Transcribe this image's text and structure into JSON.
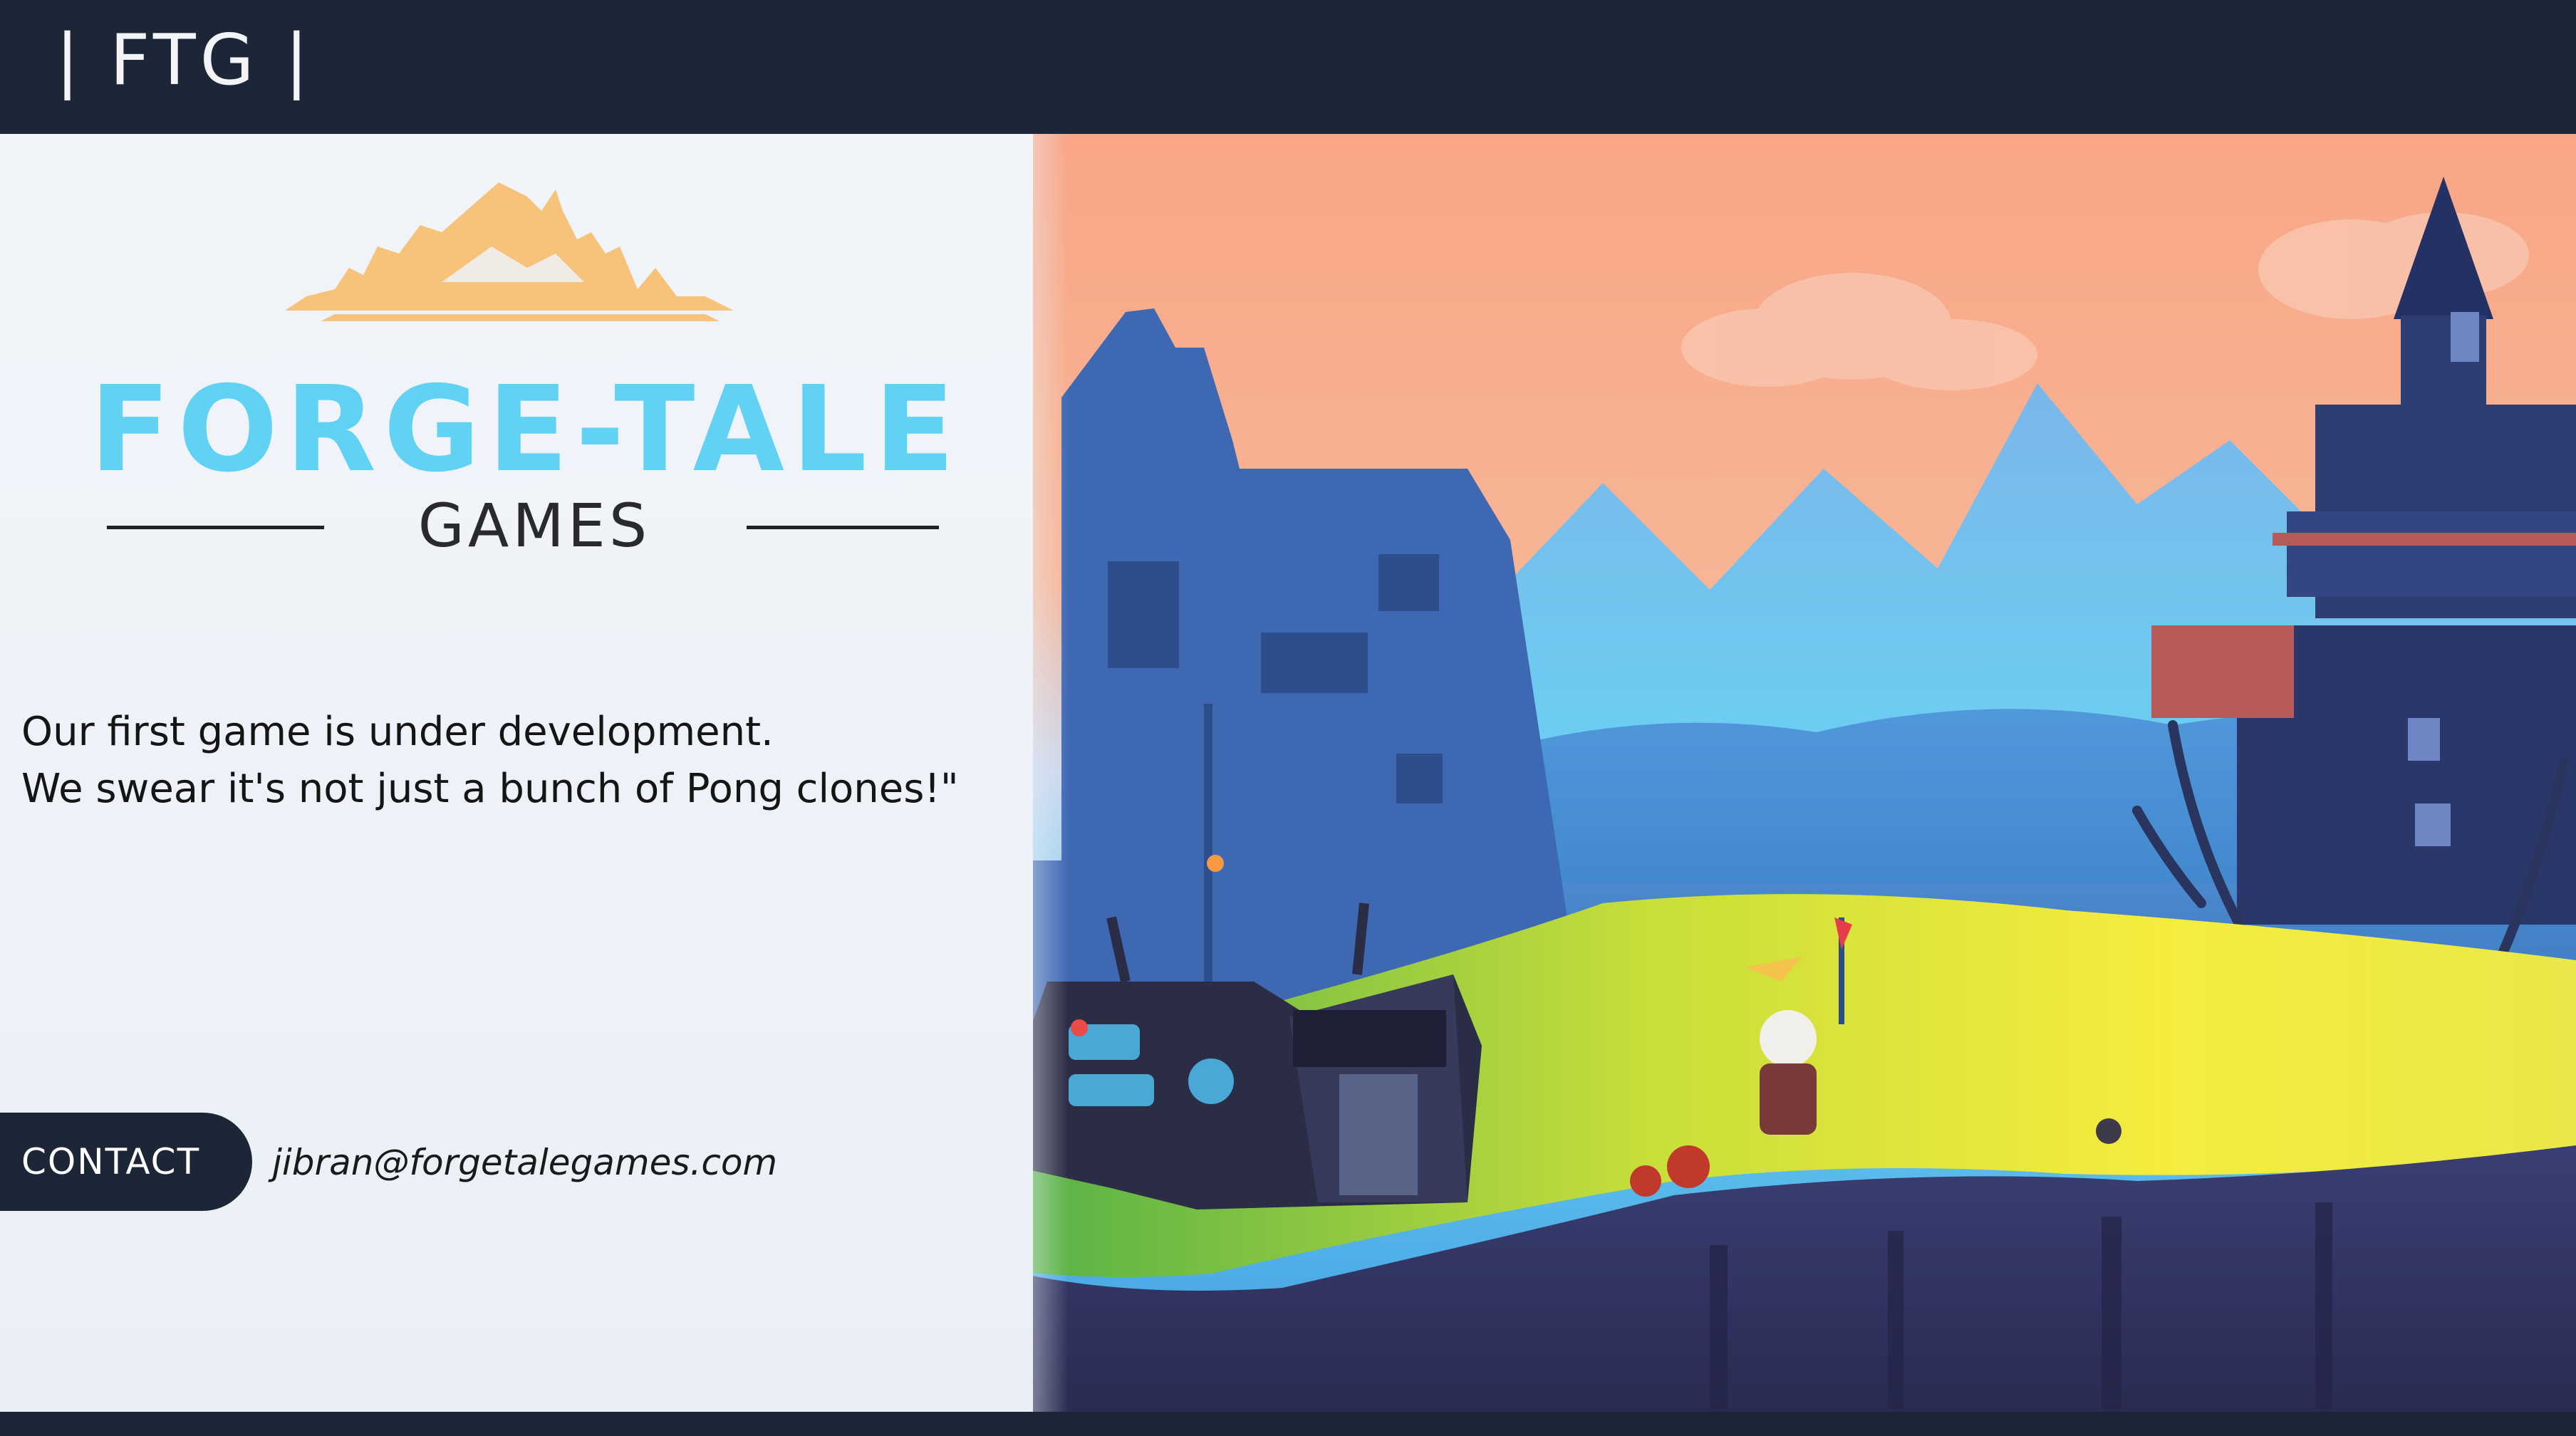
{
  "header": {
    "brand": "| FTG |"
  },
  "logo": {
    "title": "FORGE-TALE",
    "subtitle": "GAMES"
  },
  "tagline": {
    "line1": "Our first game is under development.",
    "line2": "We swear it's not just a bunch of Pong clones!\""
  },
  "contact": {
    "button_label": "CONTACT",
    "email": "jibran@forgetalegames.com"
  },
  "colors": {
    "nav_background": "#1c2637",
    "logo_cyan": "#62d2f4",
    "logo_orange": "#f7c27a",
    "sky_peach": "#f7a886",
    "grass_yellow": "#f2e63a",
    "castle_blue": "#3f68b3"
  }
}
